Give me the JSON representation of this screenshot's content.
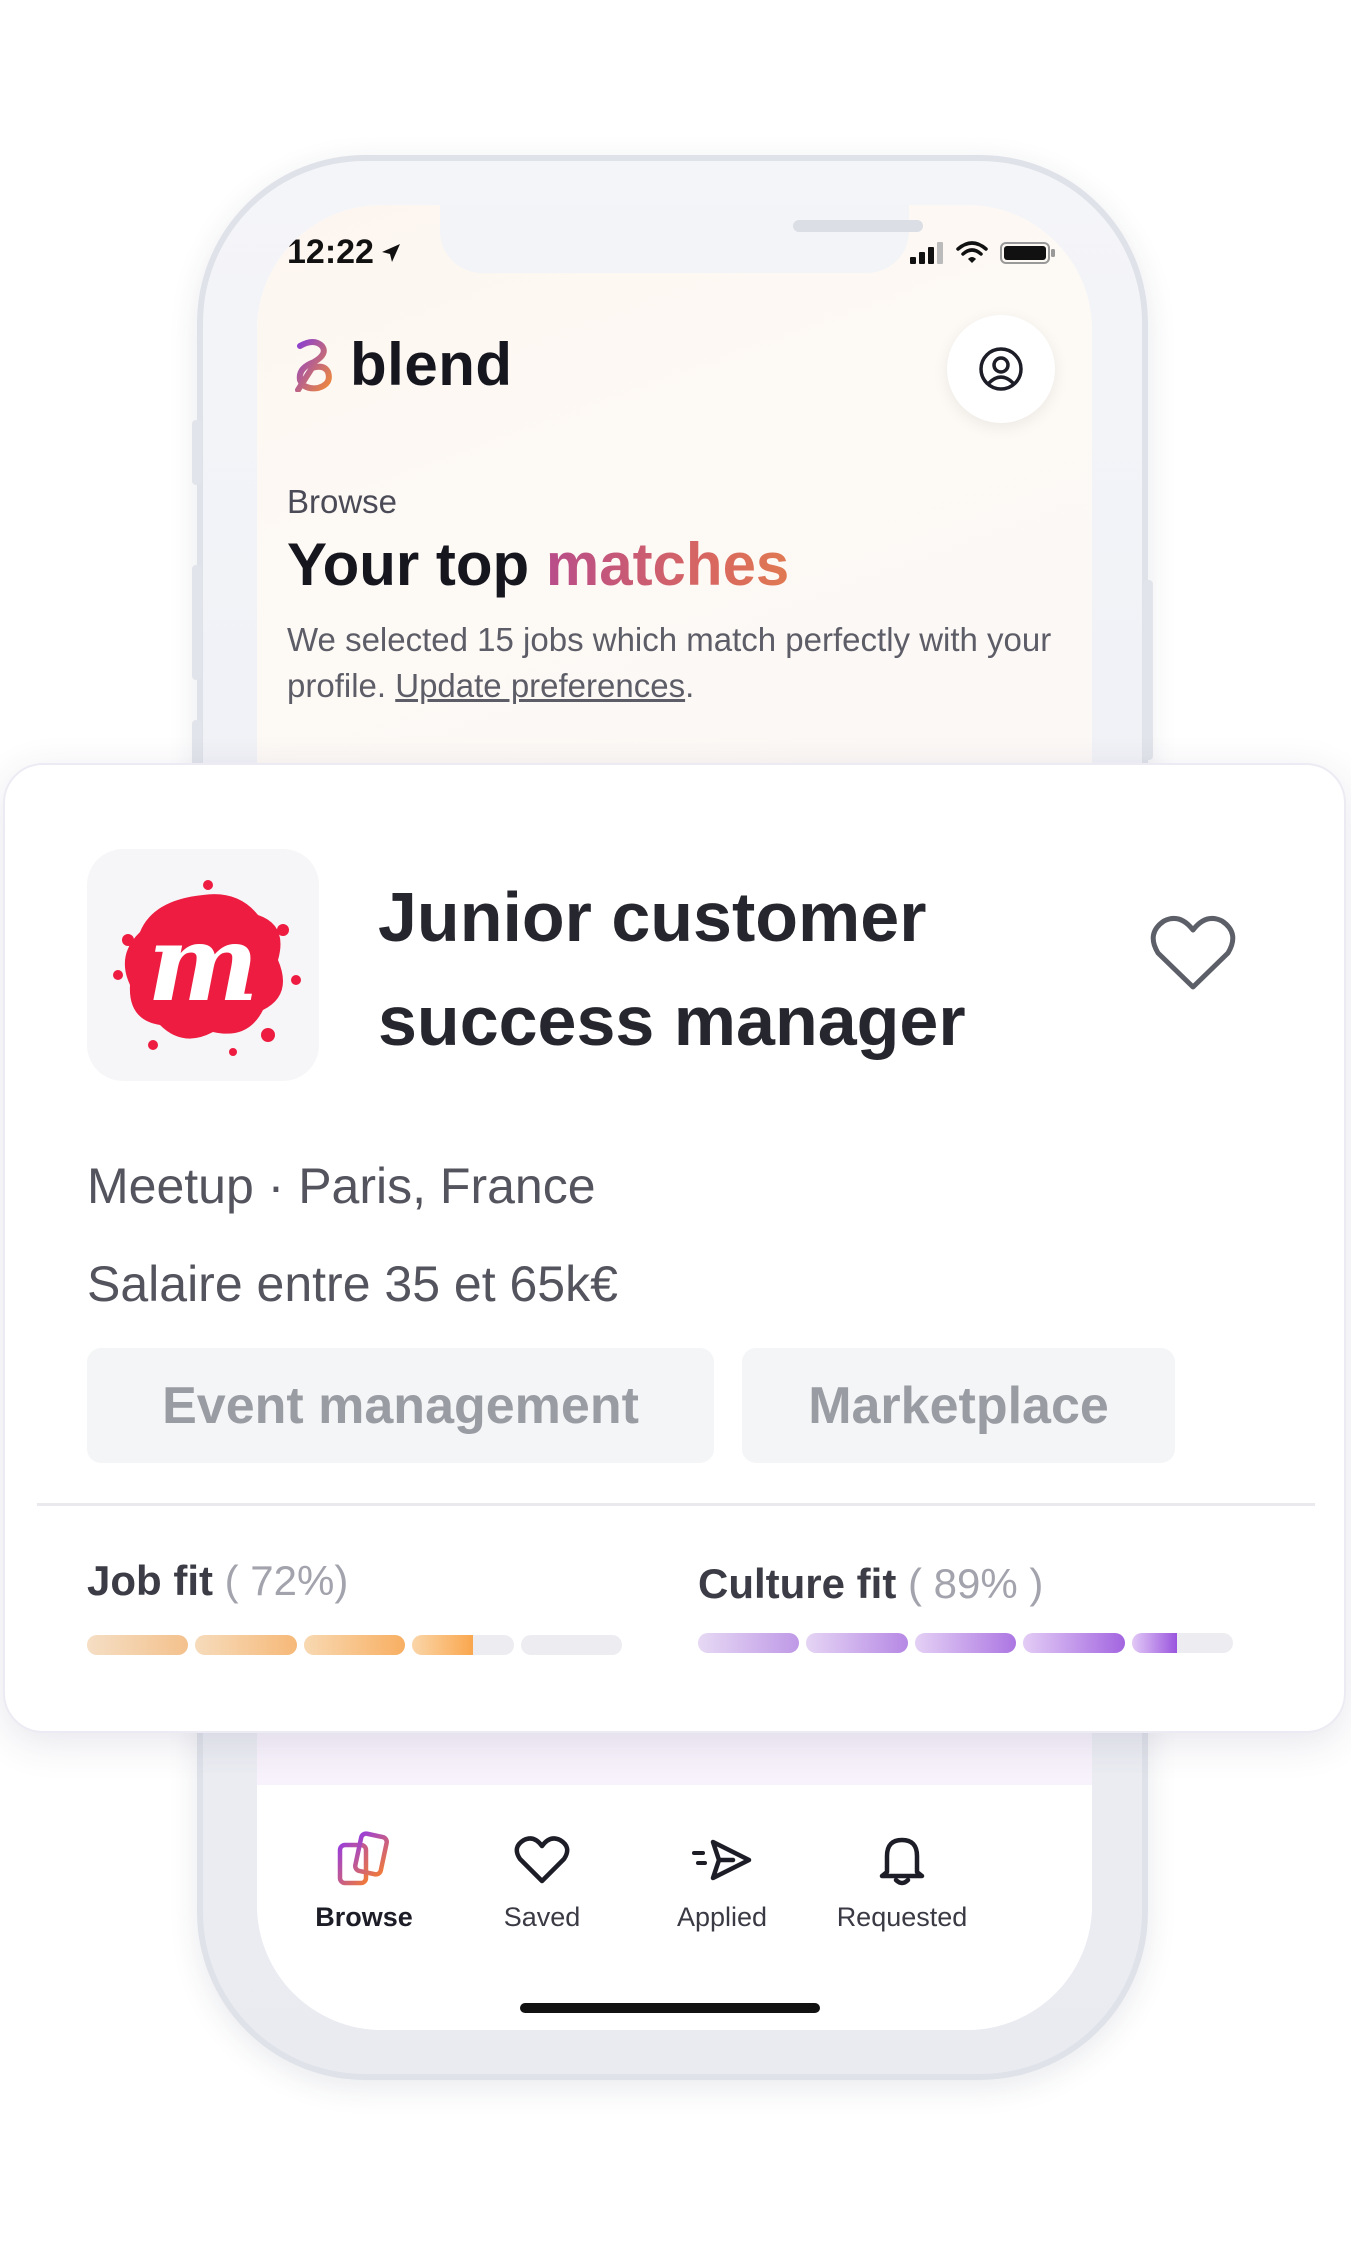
{
  "status_bar": {
    "time": "12:22"
  },
  "app": {
    "name": "blend"
  },
  "header": {
    "eyebrow": "Browse",
    "title_prefix": "Your top",
    "title_accent": "matches",
    "subtitle": "We selected 15 jobs which match perfectly with your profile.",
    "update_link": "Update preferences",
    "subtitle_end": "."
  },
  "job": {
    "title": "Junior customer success manager",
    "company_line": "Meetup · Paris, France",
    "salary": "Salaire entre 35 et 65k€",
    "logo_letter": "m",
    "tags": [
      "Event management",
      "Marketplace"
    ],
    "job_fit": {
      "label": "Job fit",
      "value_text": "( 72%)",
      "value": 0.72
    },
    "culture_fit": {
      "label": "Culture fit",
      "value_text": "( 89% )",
      "value": 0.89
    }
  },
  "nav": [
    {
      "label": "Browse",
      "icon": "browse-cards-icon",
      "active": true
    },
    {
      "label": "Saved",
      "icon": "heart-icon",
      "active": false
    },
    {
      "label": "Applied",
      "icon": "send-icon",
      "active": false
    },
    {
      "label": "Requested",
      "icon": "bell-icon",
      "active": false
    }
  ],
  "colors": {
    "accent_start": "#b84d8a",
    "accent_end": "#e07a52",
    "job_fit_start": "#fcd3a0",
    "job_fit_end": "#fb9e3a",
    "culture_fit_start": "#e2c9f6",
    "culture_fit_end": "#9a55de",
    "meetup_red": "#ed1c40"
  }
}
